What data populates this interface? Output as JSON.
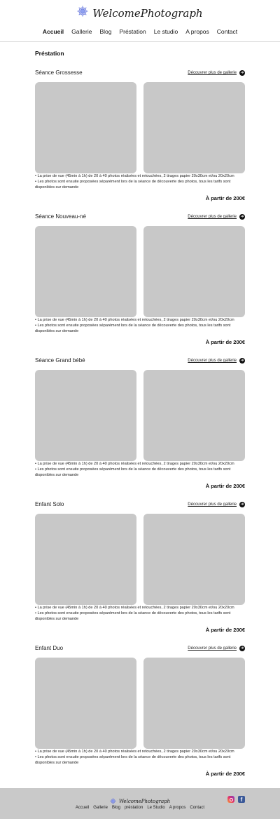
{
  "brand": {
    "name": "WelcomePhotograph",
    "logo_icon": "sun-logo-icon"
  },
  "nav": {
    "items": [
      {
        "label": "Accueil",
        "active": true
      },
      {
        "label": "Gallerie"
      },
      {
        "label": "Blog"
      },
      {
        "label": "Préstation"
      },
      {
        "label": "Le studio"
      },
      {
        "label": "A propos"
      },
      {
        "label": "Contact"
      }
    ]
  },
  "page": {
    "title": "Préstation"
  },
  "sections": [
    {
      "title": "Séance Grossesse",
      "link": "Découvrer plus de gallerie",
      "line1": "• La prise de vue (45min à 1h) de 20 à 40 photos réalisées et retouchées, 2 tirages papier 20x30cm et/ou 20x20cm",
      "line2": "• Les photos sont ensuite proposées séparément lors de la séance de découverte des photos, tous les tarifs sont disponibles sur demande",
      "price": "À partir de 200€"
    },
    {
      "title": "Séance Nouveau-né",
      "link": "Découvrer plus de gallerie",
      "line1": "• La prise de vue (45min à 1h) de 20 à 40 photos réalisées et retouchées, 2 tirages papier 20x30cm et/ou 20x20cm",
      "line2": "• Les photos sont ensuite proposées séparément lors de la séance de découverte des photos, tous les tarifs sont disponibles sur demande",
      "price": "À partir de 200€"
    },
    {
      "title": "Séance Grand bébé",
      "link": "Découvrer plus de gallerie",
      "line1": "• La prise de vue (45min à 1h) de 20 à 40 photos réalisées et retouchées, 2 tirages papier 20x30cm et/ou 20x20cm",
      "line2": "• Les photos sont ensuite proposées séparément lors de la séance de découverte des photos, tous les tarifs sont disponibles sur demande",
      "price": "À partir de 200€"
    },
    {
      "title": "Enfant Solo",
      "link": "Découvrer plus de gallerie",
      "line1": "• La prise de vue (45min à 1h) de 20 à 40 photos réalisées et retouchées, 2 tirages papier 20x30cm et/ou 20x20cm",
      "line2": "• Les photos sont ensuite proposées séparément lors de la séance de découverte des photos, tous les tarifs sont disponibles sur demande",
      "price": "À partir de 200€"
    },
    {
      "title": "Enfant Duo",
      "link": "Découvrer plus de gallerie",
      "line1": "• La prise de vue (45min à 1h) de 20 à 40 photos réalisées et retouchées, 2 tirages papier 20x30cm et/ou 20x20cm",
      "line2": "• Les photos sont ensuite proposées séparément lors de la séance de découverte des photos, tous les tarifs sont disponibles sur demande",
      "price": "À partir de 200€"
    }
  ],
  "footer": {
    "brand": "WelcomePhotograph",
    "nav": [
      "Accueil",
      "Gallerie",
      "Blog",
      "préstation",
      "Le Studio",
      "A propos",
      "Contact"
    ],
    "social": [
      "instagram-icon",
      "facebook-icon"
    ]
  },
  "colors": {
    "logo": "#6f7fe0",
    "photo_placeholder": "#c8c8c8",
    "footer_bg": "#c9c9c9"
  }
}
